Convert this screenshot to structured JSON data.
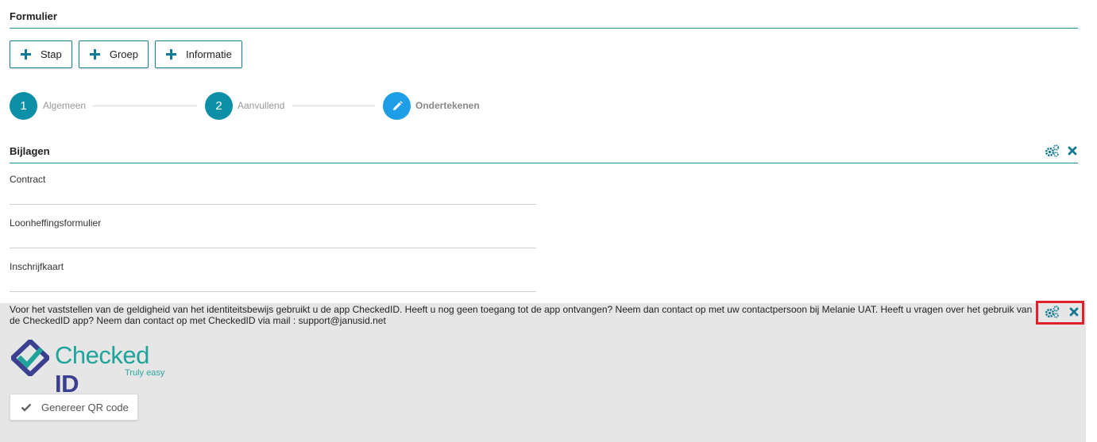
{
  "form": {
    "title": "Formulier"
  },
  "toolbar": {
    "buttons": [
      {
        "label": "Stap",
        "icon": "plus-icon"
      },
      {
        "label": "Groep",
        "icon": "plus-icon"
      },
      {
        "label": "Informatie",
        "icon": "plus-icon"
      }
    ]
  },
  "stepper": {
    "steps": [
      {
        "number": "1",
        "label": "Algemeen"
      },
      {
        "number": "2",
        "label": "Aanvullend"
      },
      {
        "number": "",
        "icon": "pencil-icon",
        "label": "Ondertekenen"
      }
    ]
  },
  "attachments": {
    "title": "Bijlagen",
    "fields": [
      {
        "label": "Contract"
      },
      {
        "label": "Loonheffingsformulier"
      },
      {
        "label": "Inschrijfkaart"
      }
    ]
  },
  "checkedid": {
    "info_text": "Voor het vaststellen van de geldigheid van het identiteitsbewijs gebruikt u de app CheckedID. Heeft u nog geen toegang tot de app ontvangen? Neem dan contact op met uw contactpersoon bij Melanie UAT. Heeft u vragen over het gebruik van de CheckedID app? Neem dan contact op met CheckedID via mail : support@janusid.net",
    "logo": {
      "word1": "Checked",
      "word2": "ID",
      "tagline": "Truly easy"
    },
    "qr_button_label": "Genereer QR code"
  },
  "colors": {
    "accent": "#0d8fa8",
    "pen_step": "#1e9ee6",
    "highlight": "#e0202a",
    "panel_bg": "#e6e6e6"
  }
}
